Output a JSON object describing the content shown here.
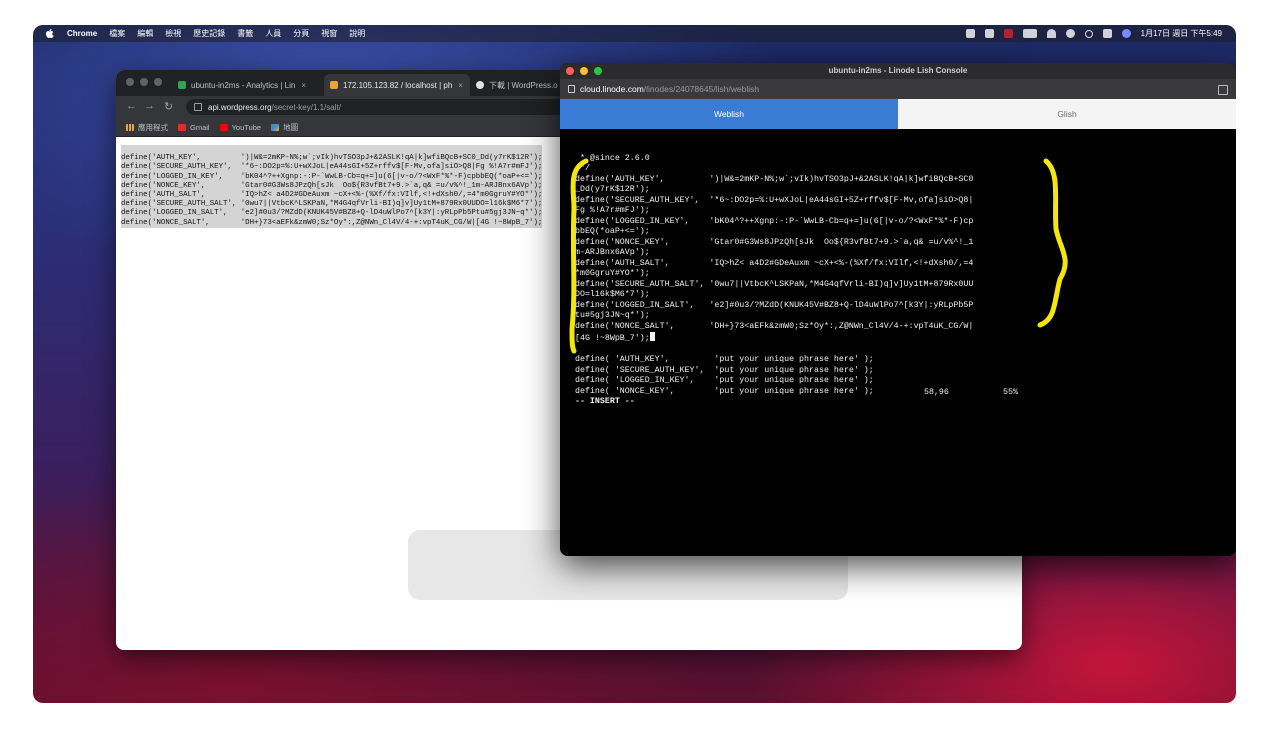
{
  "menubar": {
    "app": "Chrome",
    "items": [
      "檔案",
      "編輯",
      "檢視",
      "歷史記錄",
      "書籤",
      "人員",
      "分頁",
      "視窗",
      "說明"
    ],
    "clock": "1月17日 週日 下午5:49"
  },
  "back_window": {
    "tabs": [
      {
        "title": "ubuntu-in2ms - Analytics | Lin"
      },
      {
        "title": "172.105.123.82 / localhost | ph"
      },
      {
        "title": "下載 | WordPress.o"
      }
    ],
    "url_host": "api.wordpress.org",
    "url_path": "/secret-key/1.1/salt/",
    "bookmarks": [
      "應用程式",
      "Gmail",
      "YouTube",
      "地圖"
    ],
    "salt_lines": [
      "define('AUTH_KEY',         ')|W&=2mKP-N%;w`;vIk)hvTSO3pJ+&2ASLK!qA|k]wfiBQcB+SC0_Dd(y7rK$12R');",
      "define('SECURE_AUTH_KEY',  '*6~:DO2p=%:U+wXJoL|eA44sGI+5Z+rffv$[F-Mv,ofa]siO>Q8|Fg %!A7r#mFJ');",
      "define('LOGGED_IN_KEY',    'bK04^?++Xgnp:-:P-`WwLB-Cb=q+=]u(6[|v-o/?<WxF*%*-F)cpbbEQ(*oaP+<=');",
      "define('NONCE_KEY',        'Gtar0#G3Ws8JPzQh[sJk  Oo${R3vfBt7+9.>`a,q& =u/v%^!_1m-ARJBnx6AVp');",
      "define('AUTH_SALT',        'IQ>hZ< a4D2#GDeAuxm ~cX+<%-(%Xf/fx:VIlf,<!+dXsh0/,=4*m0GgruY#YO*');",
      "define('SECURE_AUTH_SALT', '0wu7||VtbcK^LSKPaN,*M4G4qfVrli-BI)q]v]Uy1tM+879Rx0UUDO=l16k$M6*7');",
      "define('LOGGED_IN_SALT',   'e2]#0u3/?MZdD(KNUK45V#BZ8+Q-lD4uWlPo7^[k3Y|:yRLpPb5Ptu#5gj3JN~q*');",
      "define('NONCE_SALT',       'DH+}73<aEFk&zmW0;Sz*Oy*:,Z@NWn_Cl4V/4-+:vpT4uK_CG/W|[4G !~8WpB_7');"
    ]
  },
  "front_window": {
    "title": "ubuntu-in2ms - Linode Lish Console",
    "url_host": "cloud.linode.com",
    "url_path": "/linodes/24078645/lish/weblish",
    "tabs": [
      "Weblish",
      "Glish"
    ],
    "terminal_lines": [
      " * @since 2.6.0",
      " */",
      "define('AUTH_KEY',         ')|W&=2mKP-N%;w`;vIk)hvTSO3pJ+&2ASLK!qA|k]wfiBQcB+SC0",
      "_Dd(y7rK$12R');",
      "define('SECURE_AUTH_KEY',  '*6~:DO2p=%:U+wXJoL|eA44sGI+5Z+rffv$[F-Mv,ofa]siO>Q8|",
      "Fg %!A7r#mFJ');",
      "define('LOGGED_IN_KEY',    'bK04^?++Xgnp:-:P-`WwLB-Cb=q+=]u(6[|v-o/?<WxF*%*-F)cp",
      "bbEQ(*oaP+<=');",
      "define('NONCE_KEY',        'Gtar0#G3Ws8JPzQh[sJk  Oo${R3vfBt7+9.>`a,q& =u/v%^!_1",
      "m-ARJBnx6AVp');",
      "define('AUTH_SALT',        'IQ>hZ< a4D2#GDeAuxm ~cX+<%-(%Xf/fx:VIlf,<!+dXsh0/,=4",
      "*m0GgruY#YO*');",
      "define('SECURE_AUTH_SALT', '0wu7||VtbcK^LSKPaN,*M4G4qfVrli-BI)q]v]Uy1tM+879Rx0UU",
      "DO=l16k$M6*7');",
      "define('LOGGED_IN_SALT',   'e2]#0u3/?MZdD(KNUK45V#BZ8+Q-lD4uWlPo7^[k3Y|:yRLpPb5P",
      "tu#5gj3JN~q*');",
      "define('NONCE_SALT',       'DH+}73<aEFk&zmW0;Sz*Oy*:,Z@NWn_Cl4V/4-+:vpT4uK_CG/W|",
      "[4G !~8WpB_7');",
      "",
      "define( 'AUTH_KEY',         'put your unique phrase here' );",
      "define( 'SECURE_AUTH_KEY',  'put your unique phrase here' );",
      "define( 'LOGGED_IN_KEY',    'put your unique phrase here' );",
      "define( 'NONCE_KEY',        'put your unique phrase here' );"
    ],
    "status_mode": "-- INSERT --",
    "status_position": "58,96",
    "status_percent": "55%"
  }
}
